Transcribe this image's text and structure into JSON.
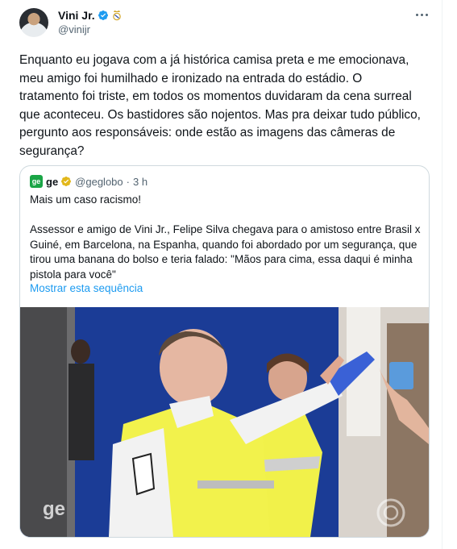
{
  "author": {
    "display_name": "Vini Jr.",
    "handle": "@vinijr",
    "avatar": "avatar-photo",
    "verified_color": "#1d9bf0"
  },
  "tweet": {
    "text": "Enquanto eu jogava com a já histórica camisa preta e me emocionava, meu amigo foi humilhado e ironizado na entrada do estádio. O tratamento foi triste, em todos os momentos duvidaram da cena surreal que aconteceu. Os bastidores são nojentos. Mas pra deixar tudo público, pergunto aos responsáveis: onde estão as imagens das câmeras de segurança?"
  },
  "quote": {
    "source_logo": "ge",
    "name": "ge",
    "handle": "@geglobo",
    "separator": "·",
    "time": "3 h",
    "text": "Mais um caso racismo!\n\nAssessor e amigo de Vini Jr., Felipe Silva chegava para o amistoso entre Brasil x Guiné, em Barcelona, na Espanha, quando foi abordado por um segurança, que tirou uma banana do bolso e teria falado: \"Mãos para cima, essa daqui é minha pistola para você\"",
    "show_thread": "Mostrar esta sequência",
    "media_watermark": "ge",
    "link_color": "#1d9bf0",
    "brand_color": "#1aa546"
  },
  "icons": [
    "more-icon",
    "verified-icon",
    "club-badge-icon",
    "gold-check-icon",
    "globo-logo-icon"
  ]
}
